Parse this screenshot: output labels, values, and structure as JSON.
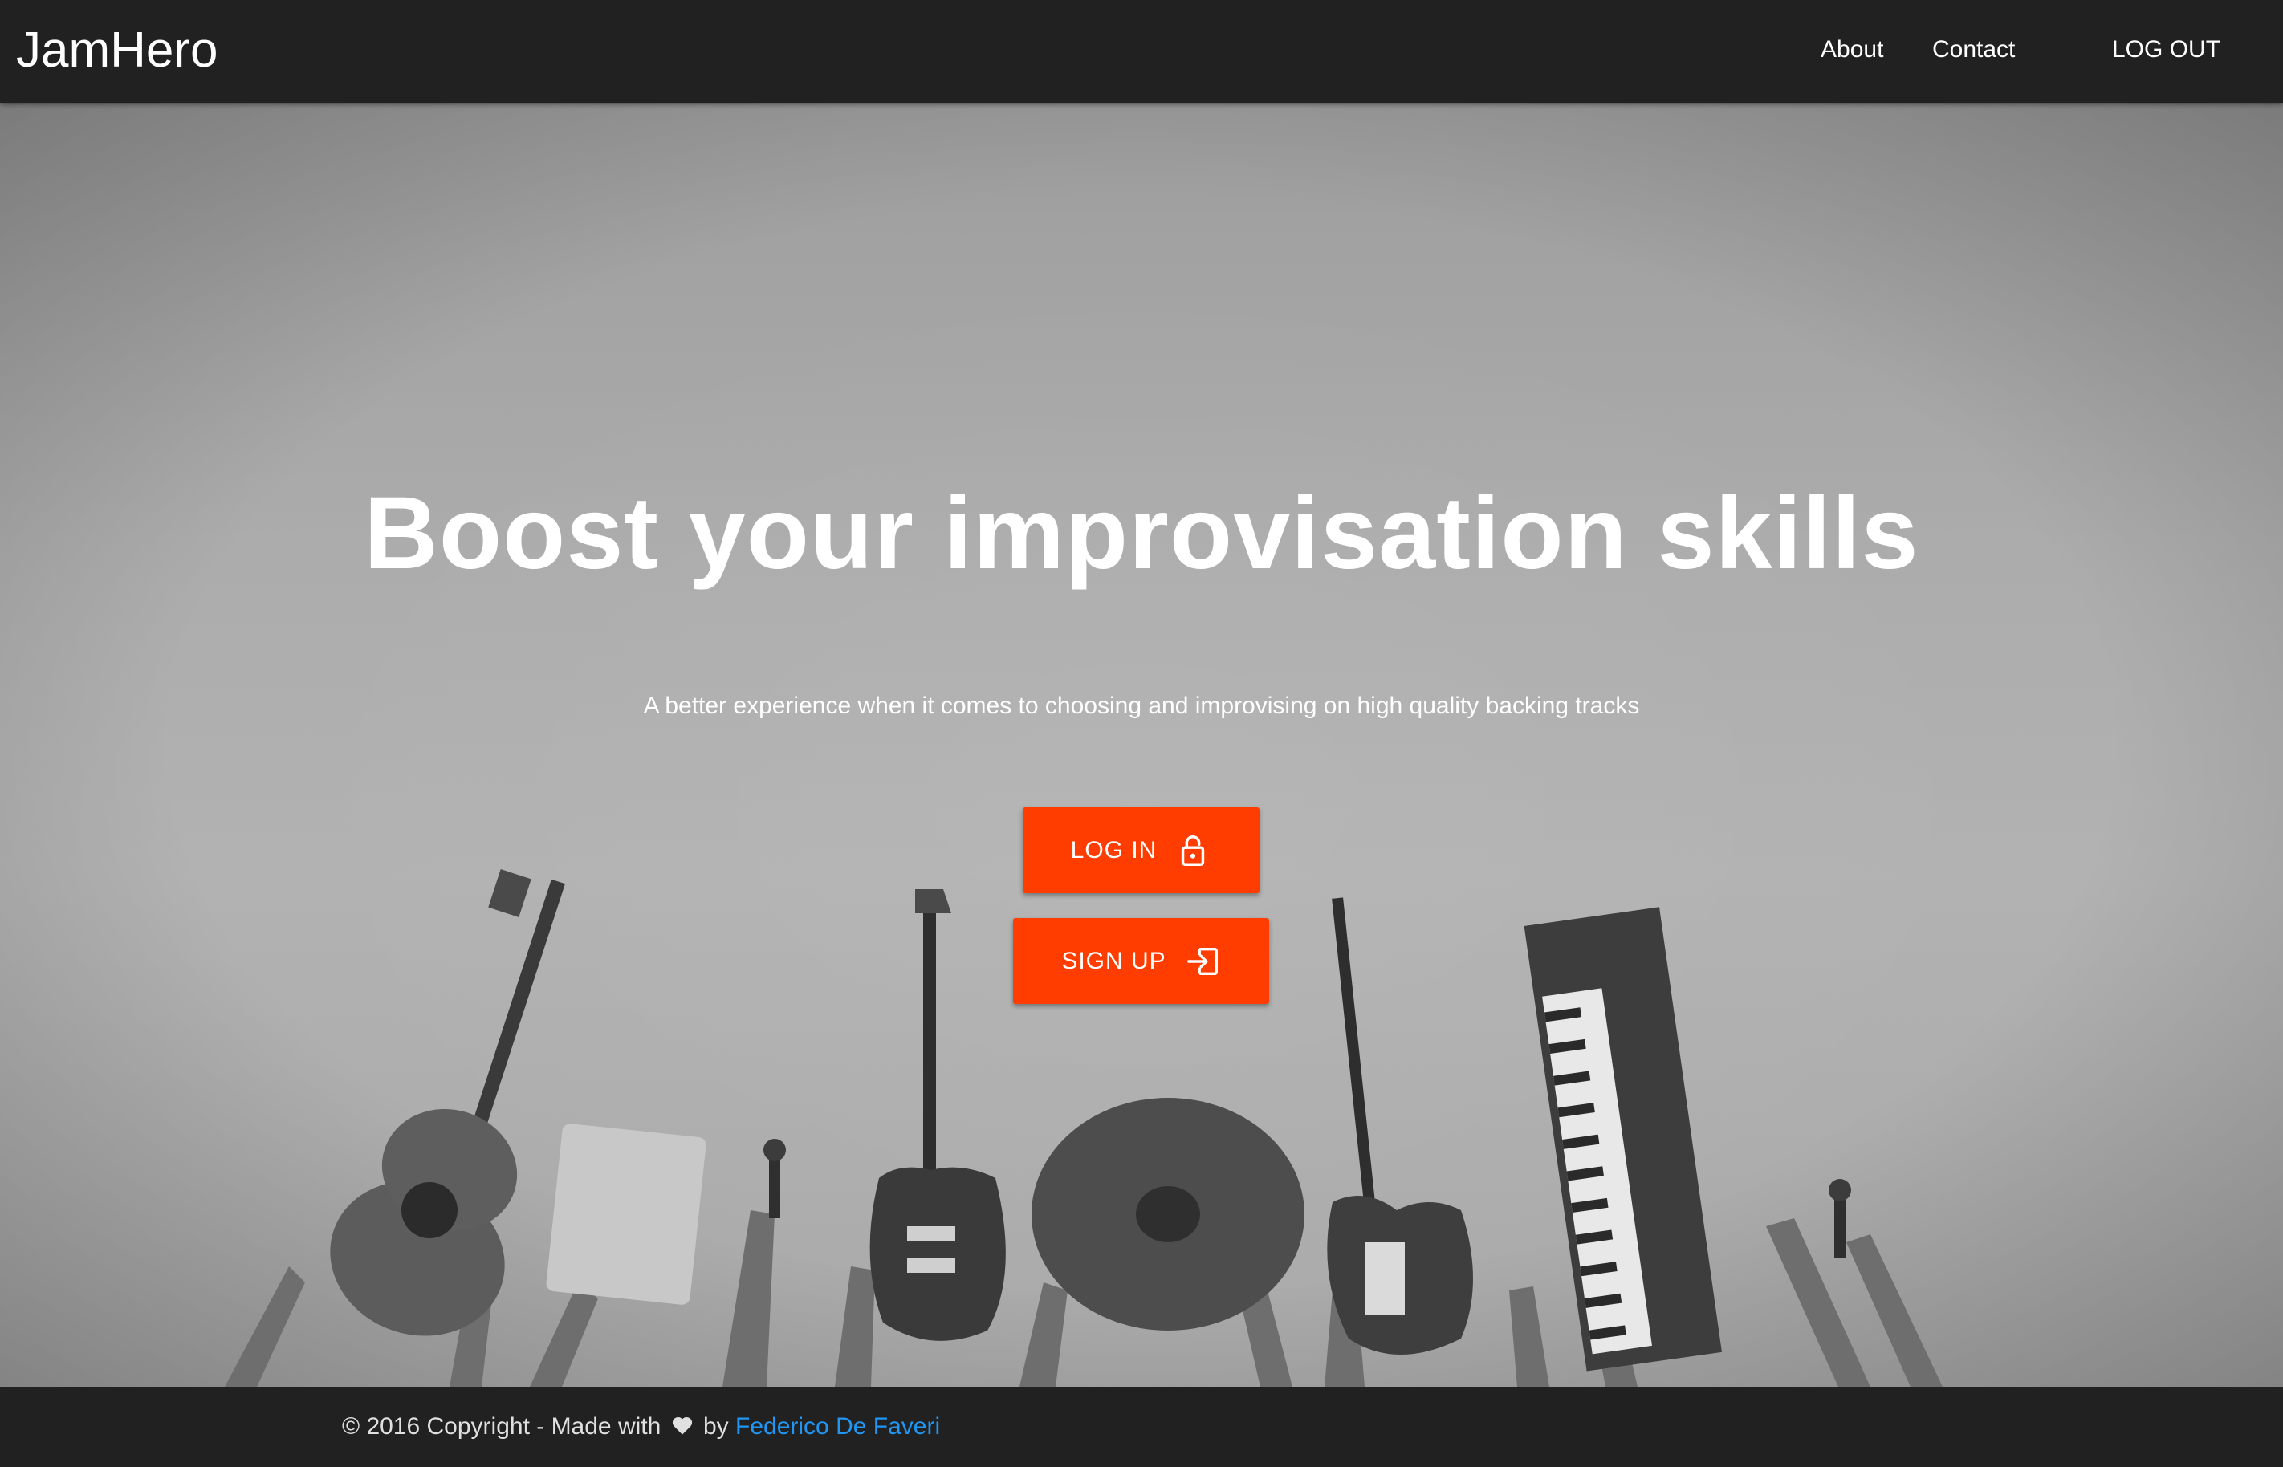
{
  "nav": {
    "brand": "JamHero",
    "links": [
      {
        "label": "About"
      },
      {
        "label": "Contact"
      },
      {
        "label": "LOG OUT"
      }
    ]
  },
  "hero": {
    "headline": "Boost your improvisation skills",
    "subheadline": "A better experience when it comes to choosing and improvising on high quality backing tracks",
    "buttons": {
      "login": {
        "label": "LOG IN",
        "icon": "lock-open-icon"
      },
      "signup": {
        "label": "SIGN UP",
        "icon": "sign-in-icon"
      }
    },
    "background": "grayscale photo of raised hands holding guitars, laptop, microphones, cymbal, bass and keyboard"
  },
  "footer": {
    "prefix": "© 2016 Copyright - Made with",
    "heart_icon": "heart-icon",
    "by": "by",
    "author": "Federico De Faveri"
  },
  "colors": {
    "nav_bg": "#212121",
    "accent": "#ff3d00",
    "link": "#2196f3",
    "text": "#ffffff"
  }
}
